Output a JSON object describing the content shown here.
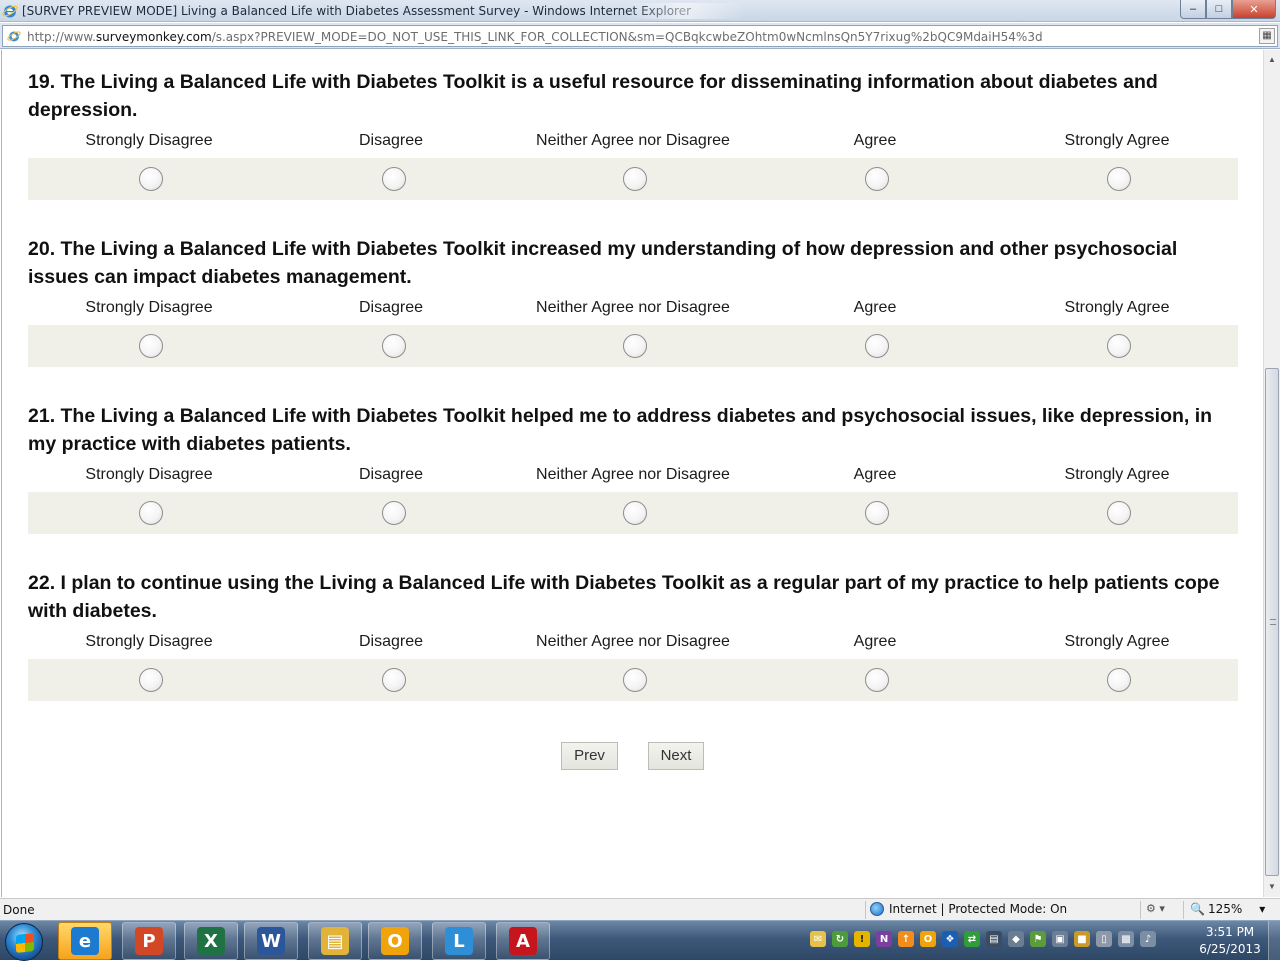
{
  "window": {
    "title": "[SURVEY PREVIEW MODE] Living a Balanced Life with Diabetes Assessment Survey - Windows Internet Explorer",
    "controls": {
      "minimize": "‒",
      "maximize": "□",
      "close": "✕"
    }
  },
  "address": {
    "url_prefix": "http://www.",
    "url_host": "surveymonkey.com",
    "url_rest": "/s.aspx?PREVIEW_MODE=DO_NOT_USE_THIS_LINK_FOR_COLLECTION&sm=QCBqkcwbeZOhtm0wNcmlnsQn5Y7rixug%2bQC9MdaiH54%3d"
  },
  "scale_labels": [
    "Strongly Disagree",
    "Disagree",
    "Neither Agree nor Disagree",
    "Agree",
    "Strongly Agree"
  ],
  "questions": [
    {
      "title": "19. The Living a Balanced Life with Diabetes Toolkit is a useful resource for disseminating information about diabetes and depression."
    },
    {
      "title": "20. The Living a Balanced Life with Diabetes Toolkit increased my understanding of how depression and other psychosocial issues can impact diabetes management."
    },
    {
      "title": "21. The Living a Balanced Life with Diabetes Toolkit helped me to address diabetes and psychosocial issues, like depression, in my practice with diabetes patients."
    },
    {
      "title": "22. I plan to continue using the Living a Balanced Life with Diabetes Toolkit as a regular part of my practice to help patients cope with diabetes."
    }
  ],
  "nav": {
    "prev": "Prev",
    "next": "Next"
  },
  "status": {
    "left": "Done",
    "zone": "Internet | Protected Mode: On",
    "zoom": "125%",
    "zoom_arrow": "▾"
  },
  "taskbar": {
    "apps": [
      {
        "name": "internet-explorer",
        "glyph": "e",
        "color": "#1d7ad1",
        "active": true
      },
      {
        "name": "powerpoint",
        "glyph": "P",
        "color": "#d24726",
        "active": false
      },
      {
        "name": "excel",
        "glyph": "X",
        "color": "#1f7244",
        "active": false
      },
      {
        "name": "word",
        "glyph": "W",
        "color": "#2b579a",
        "active": false
      },
      {
        "name": "file-explorer",
        "glyph": "▤",
        "color": "#e2b33b",
        "active": false
      },
      {
        "name": "outlook",
        "glyph": "O",
        "color": "#f0a30a",
        "active": false
      },
      {
        "name": "lync",
        "glyph": "L",
        "color": "#2f8fd6",
        "active": false
      },
      {
        "name": "acrobat",
        "glyph": "A",
        "color": "#c4161c",
        "active": false
      }
    ],
    "clock_time": "3:51 PM",
    "clock_date": "6/25/2013"
  }
}
